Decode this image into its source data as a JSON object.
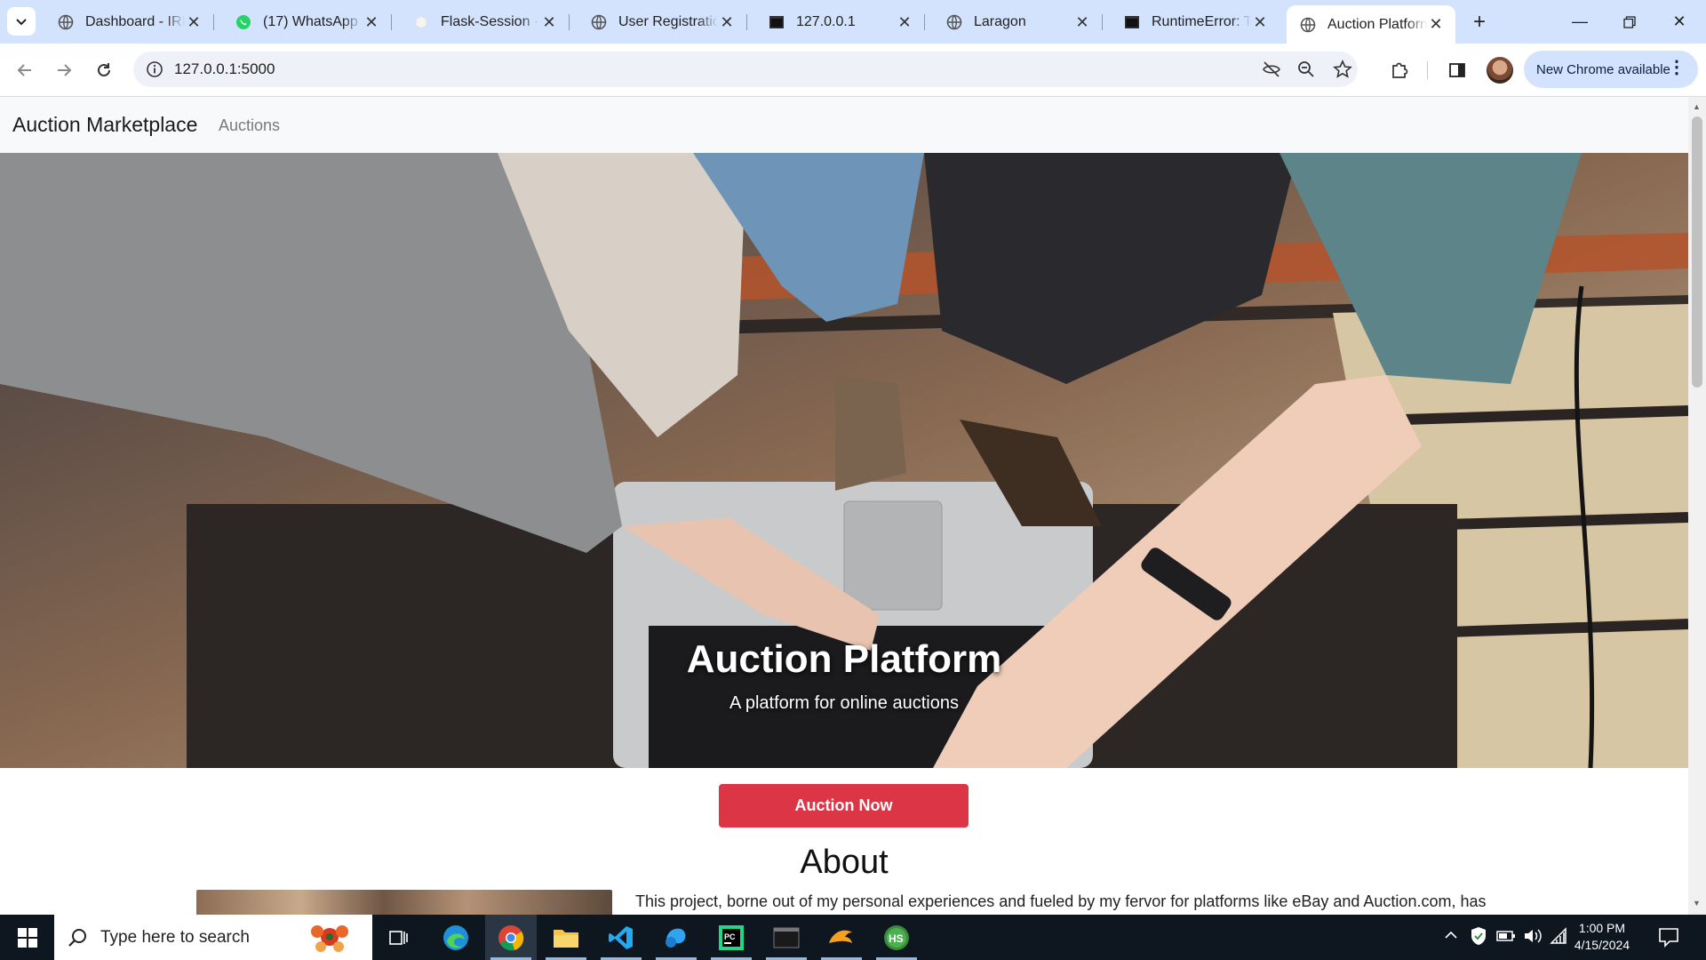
{
  "tabs": [
    {
      "title": "Dashboard - IRIS",
      "icon": "globe-icon"
    },
    {
      "title": "(17) WhatsApp",
      "icon": "whatsapp-icon"
    },
    {
      "title": "Flask-Session · PyPI",
      "icon": "pypi-icon"
    },
    {
      "title": "User Registration",
      "icon": "globe-icon"
    },
    {
      "title": "127.0.0.1",
      "icon": "terminal-icon"
    },
    {
      "title": "Laragon",
      "icon": "globe-icon"
    },
    {
      "title": "RuntimeError: The",
      "icon": "terminal-icon"
    },
    {
      "title": "Auction Platform",
      "icon": "globe-icon",
      "active": true
    }
  ],
  "toolbar": {
    "url": "127.0.0.1:5000",
    "new_chrome": "New Chrome available"
  },
  "page": {
    "brand": "Auction Marketplace",
    "nav_link": "Auctions",
    "hero_title": "Auction Platform",
    "hero_subtitle": "A platform for online auctions",
    "cta": "Auction Now",
    "about_heading": "About",
    "about_text": "This project, borne out of my personal experiences and fueled by my fervor for platforms like eBay and Auction.com, has"
  },
  "taskbar": {
    "search_placeholder": "Type here to search",
    "time": "1:00 PM",
    "date": "4/15/2024"
  },
  "colors": {
    "accent": "#dc3545",
    "tabstrip": "#d3e3fd",
    "taskbar": "#0e1620"
  }
}
